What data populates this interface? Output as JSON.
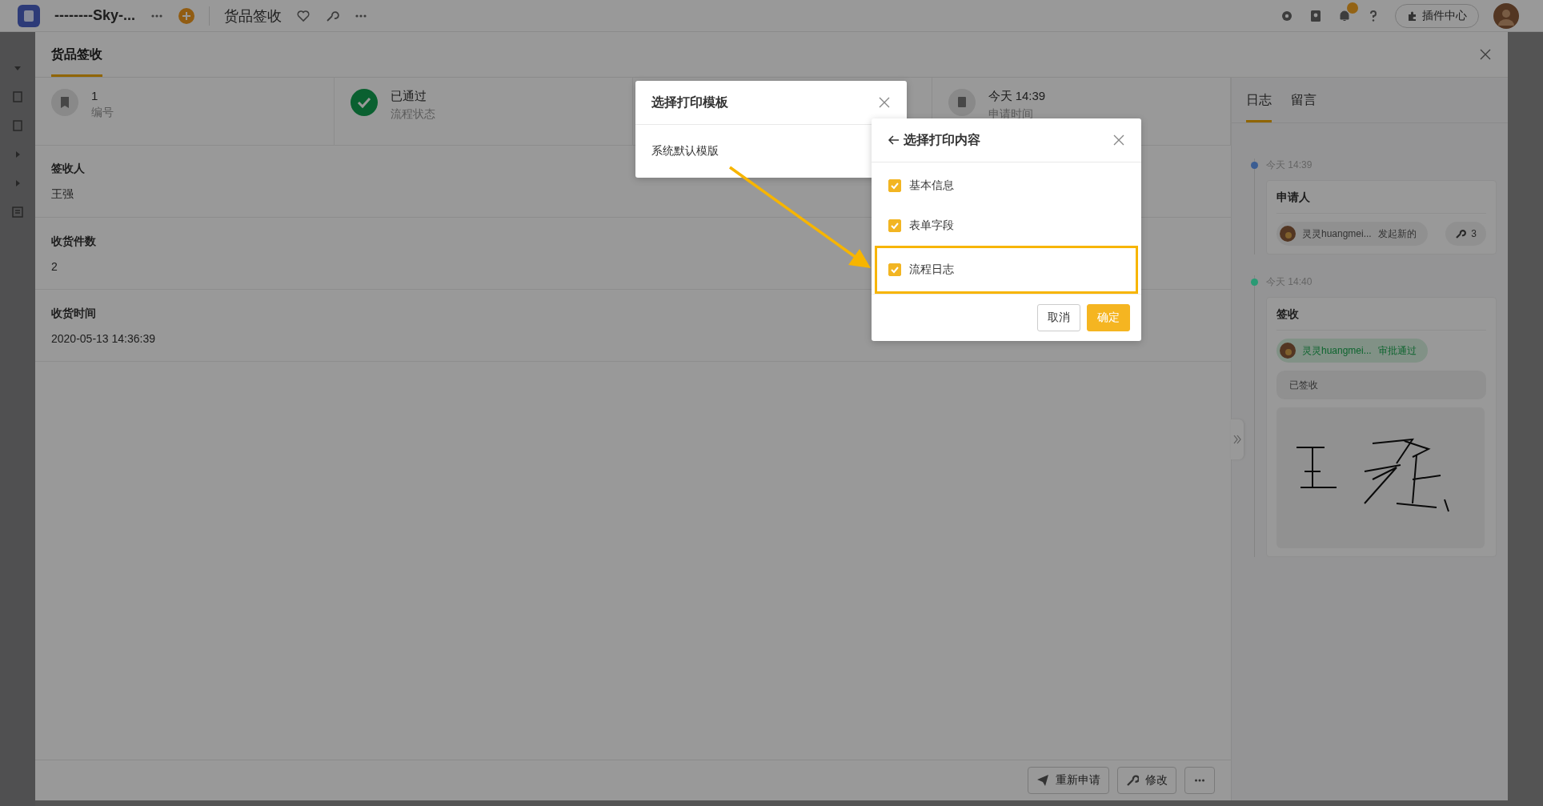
{
  "app_bar": {
    "app_name": "--------Sky-...",
    "page_title": "货品签收",
    "plugin_button": "插件中心"
  },
  "drawer": {
    "tab": "货品签收",
    "summary": [
      {
        "kind": "number",
        "value": "1",
        "label": "编号"
      },
      {
        "kind": "status",
        "value": "已通过",
        "label": "流程状态"
      },
      {
        "kind": "hidden"
      },
      {
        "kind": "time",
        "value": "今天 14:39",
        "label": "申请时间"
      }
    ],
    "fields": [
      {
        "label": "签收人",
        "value": "王强"
      },
      {
        "label": "收货件数",
        "value": "2"
      },
      {
        "label": "收货时间",
        "value": "2020-05-13 14:36:39"
      }
    ],
    "footer_buttons": [
      {
        "kind": "resubmit",
        "label": "重新申请"
      },
      {
        "kind": "edit",
        "label": "修改"
      },
      {
        "kind": "more"
      }
    ]
  },
  "side_panel": {
    "tabs": [
      {
        "label": "日志",
        "selected": true
      },
      {
        "label": "留言",
        "selected": false
      }
    ],
    "timeline": [
      {
        "time": "今天 14:39",
        "color": "#3b5d92",
        "title": "申请人",
        "actor": {
          "kind": "initiate",
          "name": "灵灵huangmei...",
          "action": "发起新的"
        },
        "tool_count": "3"
      },
      {
        "time": "今天 14:40",
        "color": "#2a9a74",
        "title": "签收",
        "actor": {
          "kind": "approve",
          "name": "灵灵huangmei...",
          "action": "审批通过"
        },
        "note": "已签收"
      }
    ]
  },
  "template_dialog": {
    "title": "选择打印模板",
    "options": [
      "系统默认模版"
    ]
  },
  "content_dialog": {
    "title": "选择打印内容",
    "items": [
      {
        "label": "基本信息",
        "checked": true,
        "highlighted": false
      },
      {
        "label": "表单字段",
        "checked": true,
        "highlighted": false
      },
      {
        "label": "流程日志",
        "checked": true,
        "highlighted": true
      }
    ],
    "cancel": "取消",
    "confirm": "确定"
  }
}
